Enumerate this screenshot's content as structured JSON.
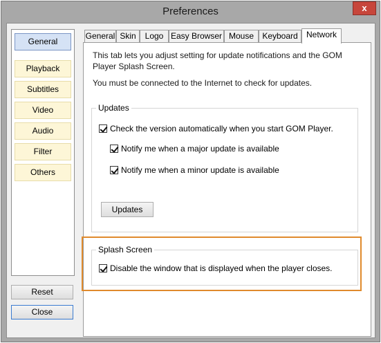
{
  "window": {
    "title": "Preferences",
    "close_glyph": "x"
  },
  "sidebar": {
    "items": [
      {
        "label": "General",
        "active": true
      },
      {
        "label": "Playback"
      },
      {
        "label": "Subtitles"
      },
      {
        "label": "Video"
      },
      {
        "label": "Audio"
      },
      {
        "label": "Filter"
      },
      {
        "label": "Others"
      }
    ],
    "reset_label": "Reset",
    "close_label": "Close"
  },
  "tabs": [
    {
      "label": "General"
    },
    {
      "label": "Skin"
    },
    {
      "label": "Logo"
    },
    {
      "label": "Easy Browser"
    },
    {
      "label": "Mouse"
    },
    {
      "label": "Keyboard"
    },
    {
      "label": "Network",
      "active": true
    }
  ],
  "network": {
    "intro": "This tab lets you adjust setting for update notifications and the GOM Player Splash Screen.",
    "connect_note": "You must be connected to the Internet to check for updates.",
    "updates_group": {
      "title": "Updates",
      "check_auto": "Check the version automatically when you start GOM Player.",
      "notify_major": "Notify me when a major update is available",
      "notify_minor": "Notify me when a minor update is available",
      "button": "Updates"
    },
    "splash_group": {
      "title": "Splash Screen",
      "disable": "Disable the window that is displayed when the player closes."
    }
  },
  "colors": {
    "highlight": "#e08a2c",
    "active_item": "#d5e2f5",
    "item_bg": "#fdf6d7",
    "close_red": "#c7463b"
  }
}
